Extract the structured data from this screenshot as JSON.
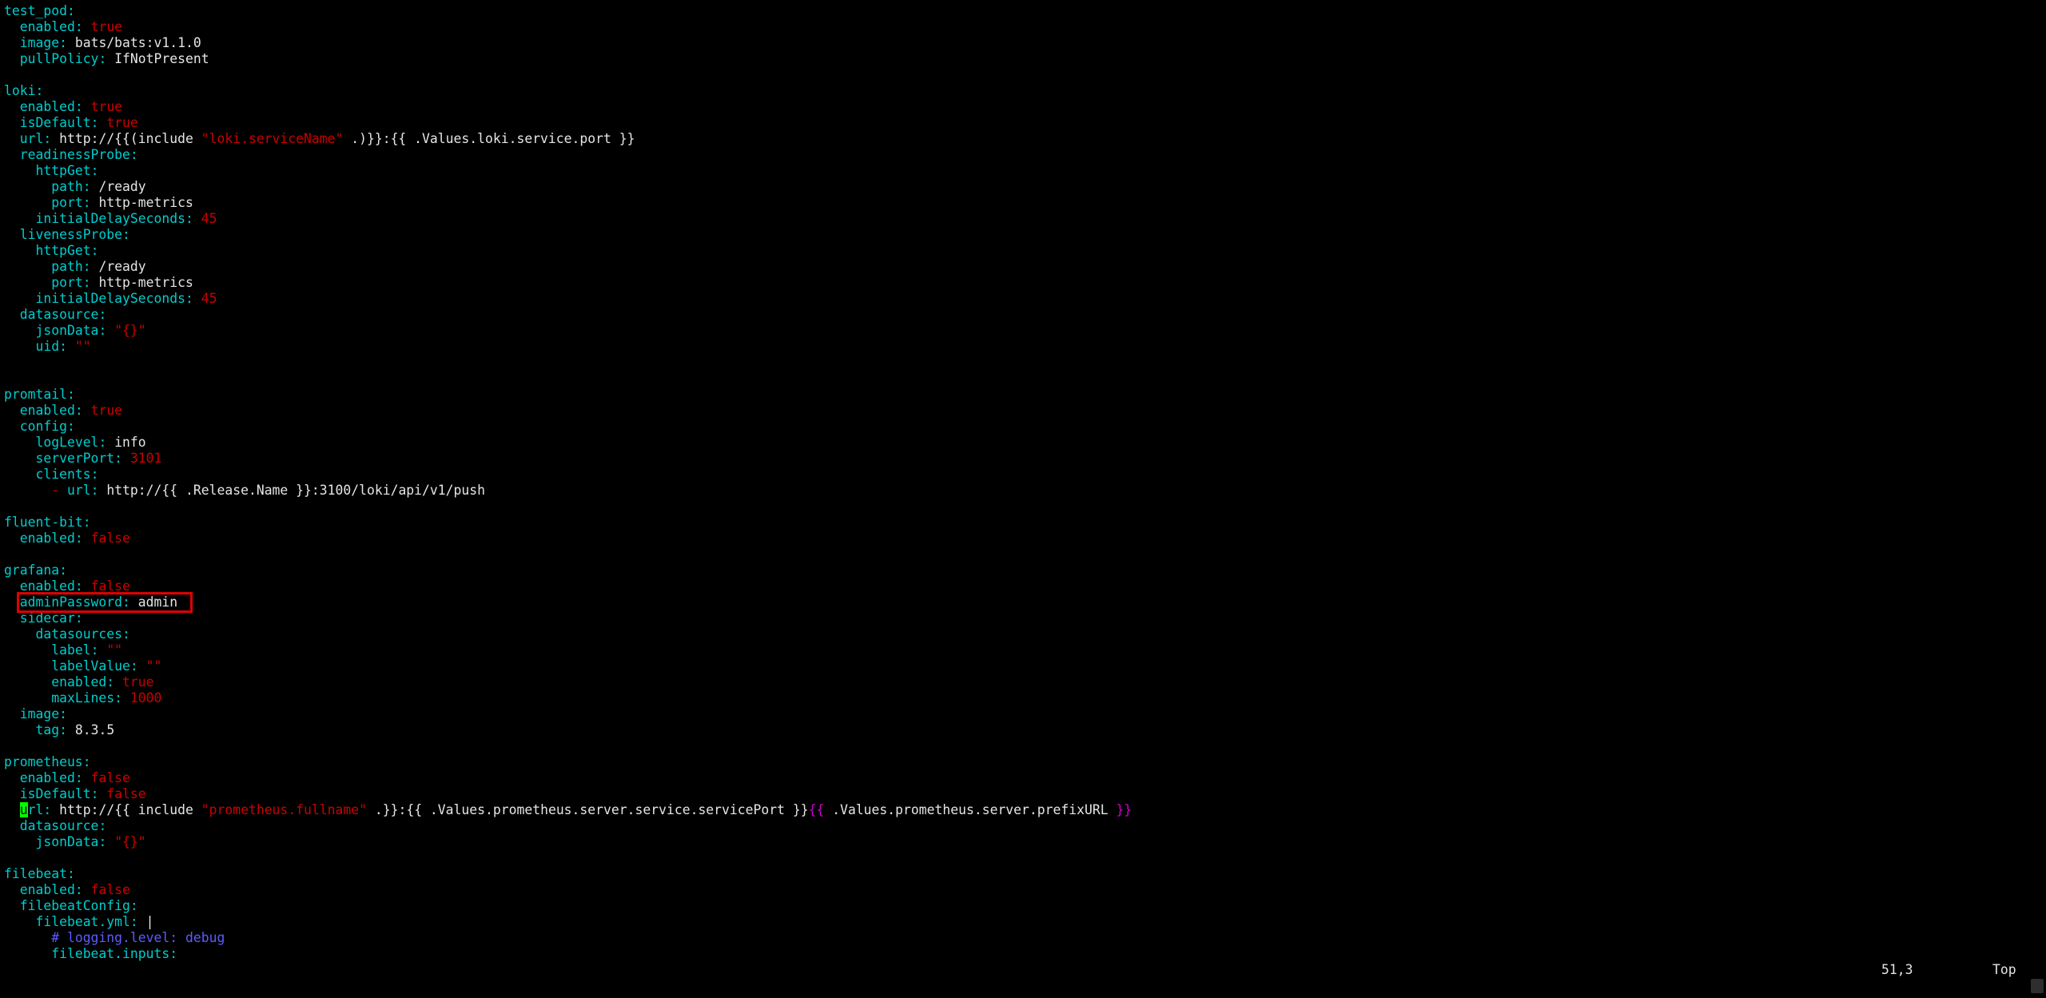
{
  "editor": {
    "lines": [
      [
        {
          "t": "test_pod",
          "c": "key"
        },
        {
          "t": ":",
          "c": "key"
        }
      ],
      [
        {
          "t": "  "
        },
        {
          "t": "enabled",
          "c": "key"
        },
        {
          "t": ": ",
          "c": "key"
        },
        {
          "t": "true",
          "c": "red"
        }
      ],
      [
        {
          "t": "  "
        },
        {
          "t": "image",
          "c": "key"
        },
        {
          "t": ": ",
          "c": "key"
        },
        {
          "t": "bats/bats:v1.1.0",
          "c": "wht"
        }
      ],
      [
        {
          "t": "  "
        },
        {
          "t": "pullPolicy",
          "c": "key"
        },
        {
          "t": ": ",
          "c": "key"
        },
        {
          "t": "IfNotPresent",
          "c": "wht"
        }
      ],
      [],
      [
        {
          "t": "loki",
          "c": "key"
        },
        {
          "t": ":",
          "c": "key"
        }
      ],
      [
        {
          "t": "  "
        },
        {
          "t": "enabled",
          "c": "key"
        },
        {
          "t": ": ",
          "c": "key"
        },
        {
          "t": "true",
          "c": "red"
        }
      ],
      [
        {
          "t": "  "
        },
        {
          "t": "isDefault",
          "c": "key"
        },
        {
          "t": ": ",
          "c": "key"
        },
        {
          "t": "true",
          "c": "red"
        }
      ],
      [
        {
          "t": "  "
        },
        {
          "t": "url",
          "c": "key"
        },
        {
          "t": ": ",
          "c": "key"
        },
        {
          "t": "http://{{(include ",
          "c": "wht"
        },
        {
          "t": "\"loki.serviceName\"",
          "c": "red"
        },
        {
          "t": " .)}}:{{ .Values.loki.service.port }}",
          "c": "wht"
        }
      ],
      [
        {
          "t": "  "
        },
        {
          "t": "readinessProbe",
          "c": "key"
        },
        {
          "t": ":",
          "c": "key"
        }
      ],
      [
        {
          "t": "    "
        },
        {
          "t": "httpGet",
          "c": "key"
        },
        {
          "t": ":",
          "c": "key"
        }
      ],
      [
        {
          "t": "      "
        },
        {
          "t": "path",
          "c": "key"
        },
        {
          "t": ": ",
          "c": "key"
        },
        {
          "t": "/ready",
          "c": "wht"
        }
      ],
      [
        {
          "t": "      "
        },
        {
          "t": "port",
          "c": "key"
        },
        {
          "t": ": ",
          "c": "key"
        },
        {
          "t": "http-metrics",
          "c": "wht"
        }
      ],
      [
        {
          "t": "    "
        },
        {
          "t": "initialDelaySeconds",
          "c": "key"
        },
        {
          "t": ": ",
          "c": "key"
        },
        {
          "t": "45",
          "c": "red"
        }
      ],
      [
        {
          "t": "  "
        },
        {
          "t": "livenessProbe",
          "c": "key"
        },
        {
          "t": ":",
          "c": "key"
        }
      ],
      [
        {
          "t": "    "
        },
        {
          "t": "httpGet",
          "c": "key"
        },
        {
          "t": ":",
          "c": "key"
        }
      ],
      [
        {
          "t": "      "
        },
        {
          "t": "path",
          "c": "key"
        },
        {
          "t": ": ",
          "c": "key"
        },
        {
          "t": "/ready",
          "c": "wht"
        }
      ],
      [
        {
          "t": "      "
        },
        {
          "t": "port",
          "c": "key"
        },
        {
          "t": ": ",
          "c": "key"
        },
        {
          "t": "http-metrics",
          "c": "wht"
        }
      ],
      [
        {
          "t": "    "
        },
        {
          "t": "initialDelaySeconds",
          "c": "key"
        },
        {
          "t": ": ",
          "c": "key"
        },
        {
          "t": "45",
          "c": "red"
        }
      ],
      [
        {
          "t": "  "
        },
        {
          "t": "datasource",
          "c": "key"
        },
        {
          "t": ":",
          "c": "key"
        }
      ],
      [
        {
          "t": "    "
        },
        {
          "t": "jsonData",
          "c": "key"
        },
        {
          "t": ": ",
          "c": "key"
        },
        {
          "t": "\"{}\"",
          "c": "red"
        }
      ],
      [
        {
          "t": "    "
        },
        {
          "t": "uid",
          "c": "key"
        },
        {
          "t": ": ",
          "c": "key"
        },
        {
          "t": "\"\"",
          "c": "red"
        }
      ],
      [],
      [],
      [
        {
          "t": "promtail",
          "c": "key"
        },
        {
          "t": ":",
          "c": "key"
        }
      ],
      [
        {
          "t": "  "
        },
        {
          "t": "enabled",
          "c": "key"
        },
        {
          "t": ": ",
          "c": "key"
        },
        {
          "t": "true",
          "c": "red"
        }
      ],
      [
        {
          "t": "  "
        },
        {
          "t": "config",
          "c": "key"
        },
        {
          "t": ":",
          "c": "key"
        }
      ],
      [
        {
          "t": "    "
        },
        {
          "t": "logLevel",
          "c": "key"
        },
        {
          "t": ": ",
          "c": "key"
        },
        {
          "t": "info",
          "c": "wht"
        }
      ],
      [
        {
          "t": "    "
        },
        {
          "t": "serverPort",
          "c": "key"
        },
        {
          "t": ": ",
          "c": "key"
        },
        {
          "t": "3101",
          "c": "red"
        }
      ],
      [
        {
          "t": "    "
        },
        {
          "t": "clients",
          "c": "key"
        },
        {
          "t": ":",
          "c": "key"
        }
      ],
      [
        {
          "t": "      "
        },
        {
          "t": "- ",
          "c": "red"
        },
        {
          "t": "url",
          "c": "key"
        },
        {
          "t": ": ",
          "c": "key"
        },
        {
          "t": "http://{{ .Release.Name }}:3100/loki/api/v1/push",
          "c": "wht"
        }
      ],
      [],
      [
        {
          "t": "fluent-bit",
          "c": "key"
        },
        {
          "t": ":",
          "c": "key"
        }
      ],
      [
        {
          "t": "  "
        },
        {
          "t": "enabled",
          "c": "key"
        },
        {
          "t": ": ",
          "c": "key"
        },
        {
          "t": "false",
          "c": "red"
        }
      ],
      [],
      [
        {
          "t": "grafana",
          "c": "key"
        },
        {
          "t": ":",
          "c": "key"
        }
      ],
      [
        {
          "t": "  "
        },
        {
          "t": "enabled",
          "c": "key"
        },
        {
          "t": ": ",
          "c": "key"
        },
        {
          "t": "false",
          "c": "red"
        }
      ],
      [
        {
          "t": "  "
        },
        {
          "t": "adminPassword",
          "c": "key"
        },
        {
          "t": ": ",
          "c": "key"
        },
        {
          "t": "admin",
          "c": "wht"
        }
      ],
      [
        {
          "t": "  "
        },
        {
          "t": "sidecar",
          "c": "key"
        },
        {
          "t": ":",
          "c": "key"
        }
      ],
      [
        {
          "t": "    "
        },
        {
          "t": "datasources",
          "c": "key"
        },
        {
          "t": ":",
          "c": "key"
        }
      ],
      [
        {
          "t": "      "
        },
        {
          "t": "label",
          "c": "key"
        },
        {
          "t": ": ",
          "c": "key"
        },
        {
          "t": "\"\"",
          "c": "red"
        }
      ],
      [
        {
          "t": "      "
        },
        {
          "t": "labelValue",
          "c": "key"
        },
        {
          "t": ": ",
          "c": "key"
        },
        {
          "t": "\"\"",
          "c": "red"
        }
      ],
      [
        {
          "t": "      "
        },
        {
          "t": "enabled",
          "c": "key"
        },
        {
          "t": ": ",
          "c": "key"
        },
        {
          "t": "true",
          "c": "red"
        }
      ],
      [
        {
          "t": "      "
        },
        {
          "t": "maxLines",
          "c": "key"
        },
        {
          "t": ": ",
          "c": "key"
        },
        {
          "t": "1000",
          "c": "red"
        }
      ],
      [
        {
          "t": "  "
        },
        {
          "t": "image",
          "c": "key"
        },
        {
          "t": ":",
          "c": "key"
        }
      ],
      [
        {
          "t": "    "
        },
        {
          "t": "tag",
          "c": "key"
        },
        {
          "t": ": ",
          "c": "key"
        },
        {
          "t": "8.3.5",
          "c": "wht"
        }
      ],
      [],
      [
        {
          "t": "prometheus",
          "c": "key"
        },
        {
          "t": ":",
          "c": "key"
        }
      ],
      [
        {
          "t": "  "
        },
        {
          "t": "enabled",
          "c": "key"
        },
        {
          "t": ": ",
          "c": "key"
        },
        {
          "t": "false",
          "c": "red"
        }
      ],
      [
        {
          "t": "  "
        },
        {
          "t": "isDefault",
          "c": "key"
        },
        {
          "t": ": ",
          "c": "key"
        },
        {
          "t": "false",
          "c": "red"
        }
      ],
      [
        {
          "t": "  "
        },
        {
          "t": "u",
          "c": "cursor"
        },
        {
          "t": "rl",
          "c": "key"
        },
        {
          "t": ": ",
          "c": "key"
        },
        {
          "t": "http://{{ include ",
          "c": "wht"
        },
        {
          "t": "\"prometheus.fullname\"",
          "c": "red"
        },
        {
          "t": " .}}:{{ .Values.prometheus.server.service.servicePort }}",
          "c": "wht"
        },
        {
          "t": "{{",
          "c": "mag"
        },
        {
          "t": " .Values.prometheus.server.prefixURL ",
          "c": "wht"
        },
        {
          "t": "}}",
          "c": "mag"
        }
      ],
      [
        {
          "t": "  "
        },
        {
          "t": "datasource",
          "c": "key"
        },
        {
          "t": ":",
          "c": "key"
        }
      ],
      [
        {
          "t": "    "
        },
        {
          "t": "jsonData",
          "c": "key"
        },
        {
          "t": ": ",
          "c": "key"
        },
        {
          "t": "\"{}\"",
          "c": "red"
        }
      ],
      [],
      [
        {
          "t": "filebeat",
          "c": "key"
        },
        {
          "t": ":",
          "c": "key"
        }
      ],
      [
        {
          "t": "  "
        },
        {
          "t": "enabled",
          "c": "key"
        },
        {
          "t": ": ",
          "c": "key"
        },
        {
          "t": "false",
          "c": "red"
        }
      ],
      [
        {
          "t": "  "
        },
        {
          "t": "filebeatConfig",
          "c": "key"
        },
        {
          "t": ":",
          "c": "key"
        }
      ],
      [
        {
          "t": "    "
        },
        {
          "t": "filebeat.yml",
          "c": "key"
        },
        {
          "t": ": ",
          "c": "key"
        },
        {
          "t": "|",
          "c": "wht"
        }
      ],
      [
        {
          "t": "      "
        },
        {
          "t": "# logging.level: debug",
          "c": "blu"
        }
      ],
      [
        {
          "t": "      "
        },
        {
          "t": "filebeat.inputs",
          "c": "key"
        },
        {
          "t": ":",
          "c": "key"
        }
      ]
    ]
  },
  "status_bar": {
    "cursor_position": "51,3",
    "scroll_position": "Top"
  },
  "colors": {
    "background": "#000000",
    "key": "#00cdcd",
    "value_literal": "#cd0000",
    "value_plain": "#e5e5e5",
    "template_delim": "#cd00cd",
    "comment": "#5c5cff",
    "cursor": "#00ff00",
    "highlight_box": "#e00000"
  }
}
